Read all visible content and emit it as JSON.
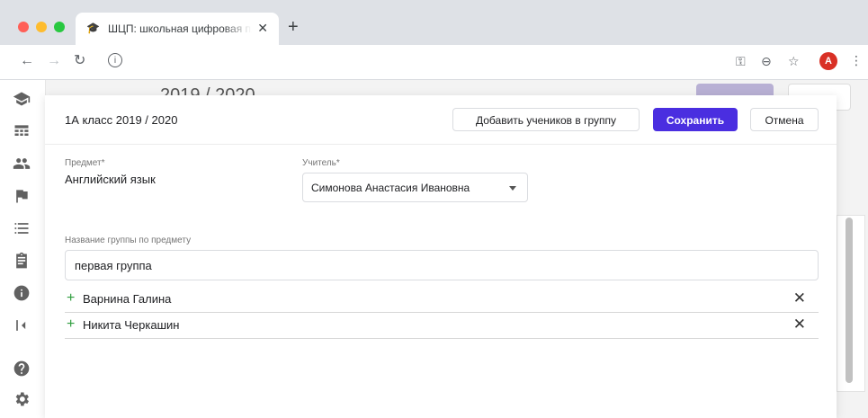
{
  "browser": {
    "tab_title": "ШЦП: школьная цифровая платформа",
    "tab_close": "✕",
    "new_tab": "+",
    "avatar_letter": "A"
  },
  "background": {
    "page_title": "2019 / 2020"
  },
  "modal": {
    "title": "1А класс 2019 / 2020",
    "add_students_label": "Добавить учеников в группу",
    "save_label": "Сохранить",
    "cancel_label": "Отмена",
    "subject_label": "Предмет*",
    "subject_value": "Английский язык",
    "teacher_label": "Учитель*",
    "teacher_value": "Симонова Анастасия Ивановна",
    "group_name_label": "Название группы по предмету",
    "group_name_value": "первая группа",
    "students": [
      {
        "name": "Варнина Галина"
      },
      {
        "name": "Никита Черкашин"
      }
    ]
  },
  "colors": {
    "primary": "#4a2ee0",
    "add_icon": "#2e9d3e",
    "avatar": "#d93025"
  }
}
